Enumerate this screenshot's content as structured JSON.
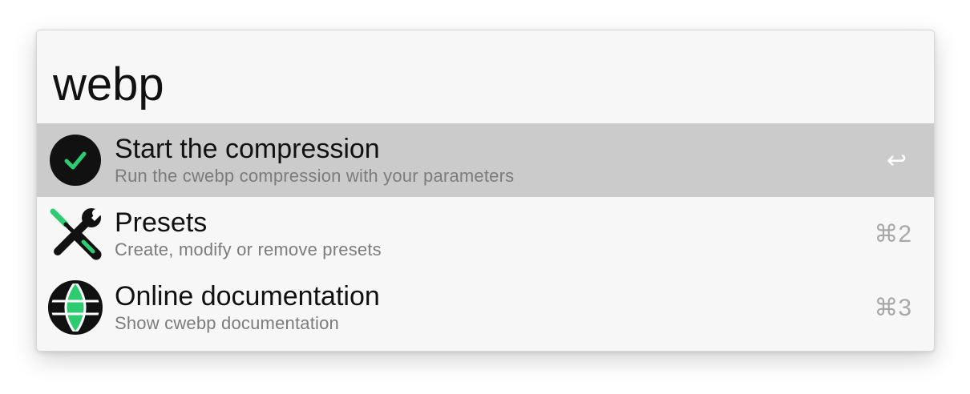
{
  "search": {
    "query": "webp"
  },
  "colors": {
    "accent": "#2ecc71",
    "selected_row": "#cbcbcb",
    "panel_bg": "#f7f7f7"
  },
  "results": [
    {
      "title": "Start the compression",
      "subtitle": "Run the cwebp compression with your parameters",
      "shortcut": "↩",
      "icon": "checkmark-circle-icon",
      "selected": true
    },
    {
      "title": "Presets",
      "subtitle": "Create, modify or remove presets",
      "shortcut": "⌘2",
      "icon": "tools-icon",
      "selected": false
    },
    {
      "title": "Online documentation",
      "subtitle": "Show cwebp documentation",
      "shortcut": "⌘3",
      "icon": "globe-icon",
      "selected": false
    }
  ]
}
